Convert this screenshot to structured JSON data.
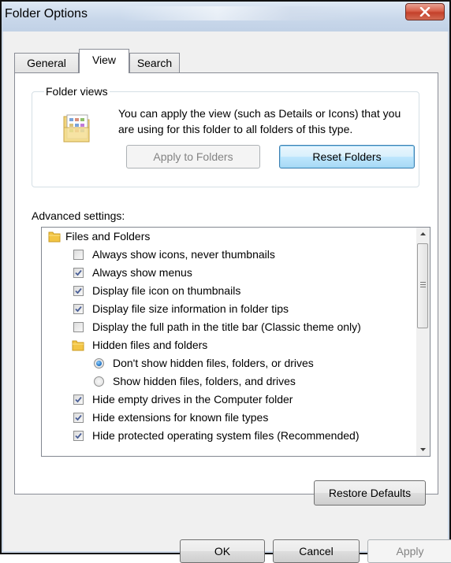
{
  "window": {
    "title": "Folder Options",
    "close_icon": "close-icon"
  },
  "tabs": [
    {
      "label": "General",
      "selected": false
    },
    {
      "label": "View",
      "selected": true
    },
    {
      "label": "Search",
      "selected": false
    }
  ],
  "folder_views": {
    "label": "Folder views",
    "description": "You can apply the view (such as Details or Icons) that you are using for this folder to all folders of this type.",
    "apply_button": "Apply to Folders",
    "reset_button": "Reset Folders",
    "icon": "folder-view-icon"
  },
  "advanced": {
    "label": "Advanced settings:",
    "items": [
      {
        "type": "folder",
        "label": "Files and Folders",
        "level": 0
      },
      {
        "type": "checkbox",
        "label": "Always show icons, never thumbnails",
        "checked": false,
        "level": 1
      },
      {
        "type": "checkbox",
        "label": "Always show menus",
        "checked": true,
        "level": 1
      },
      {
        "type": "checkbox",
        "label": "Display file icon on thumbnails",
        "checked": true,
        "level": 1
      },
      {
        "type": "checkbox",
        "label": "Display file size information in folder tips",
        "checked": true,
        "level": 1
      },
      {
        "type": "checkbox",
        "label": "Display the full path in the title bar (Classic theme only)",
        "checked": false,
        "level": 1
      },
      {
        "type": "folder",
        "label": "Hidden files and folders",
        "level": 1
      },
      {
        "type": "radio",
        "label": "Don't show hidden files, folders, or drives",
        "checked": true,
        "level": 2
      },
      {
        "type": "radio",
        "label": "Show hidden files, folders, and drives",
        "checked": false,
        "level": 2
      },
      {
        "type": "checkbox",
        "label": "Hide empty drives in the Computer folder",
        "checked": true,
        "level": 1
      },
      {
        "type": "checkbox",
        "label": "Hide extensions for known file types",
        "checked": true,
        "level": 1
      },
      {
        "type": "checkbox",
        "label": "Hide protected operating system files (Recommended)",
        "checked": true,
        "level": 1
      }
    ]
  },
  "buttons": {
    "restore_defaults": "Restore Defaults",
    "ok": "OK",
    "cancel": "Cancel",
    "apply": "Apply"
  },
  "colors": {
    "close_button": "#c4402a",
    "focus_button_border": "#3c7fb1",
    "checkmark": "#4a5f97"
  }
}
